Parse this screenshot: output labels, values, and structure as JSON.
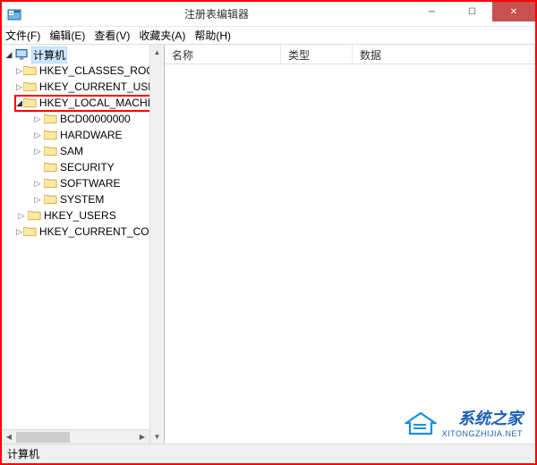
{
  "window": {
    "title": "注册表编辑器"
  },
  "menu": {
    "file": "文件(F)",
    "edit": "编辑(E)",
    "view": "查看(V)",
    "favorites": "收藏夹(A)",
    "help": "帮助(H)"
  },
  "tree": {
    "root_label": "计算机",
    "hives": [
      {
        "label": "HKEY_CLASSES_ROOT",
        "expanded": false,
        "children": []
      },
      {
        "label": "HKEY_CURRENT_USER",
        "expanded": false,
        "children": []
      },
      {
        "label": "HKEY_LOCAL_MACHINE",
        "expanded": true,
        "highlighted": true,
        "children": [
          {
            "label": "BCD00000000"
          },
          {
            "label": "HARDWARE"
          },
          {
            "label": "SAM"
          },
          {
            "label": "SECURITY"
          },
          {
            "label": "SOFTWARE"
          },
          {
            "label": "SYSTEM"
          }
        ]
      },
      {
        "label": "HKEY_USERS",
        "expanded": false,
        "children": []
      },
      {
        "label": "HKEY_CURRENT_CONFIG",
        "expanded": false,
        "children": []
      }
    ]
  },
  "list": {
    "columns": {
      "name": "名称",
      "type": "类型",
      "data": "数据"
    },
    "rows": []
  },
  "statusbar": {
    "path": "计算机"
  },
  "watermark": {
    "line1": "系统之家",
    "line2": "XITONGZHIJIA.NET"
  }
}
